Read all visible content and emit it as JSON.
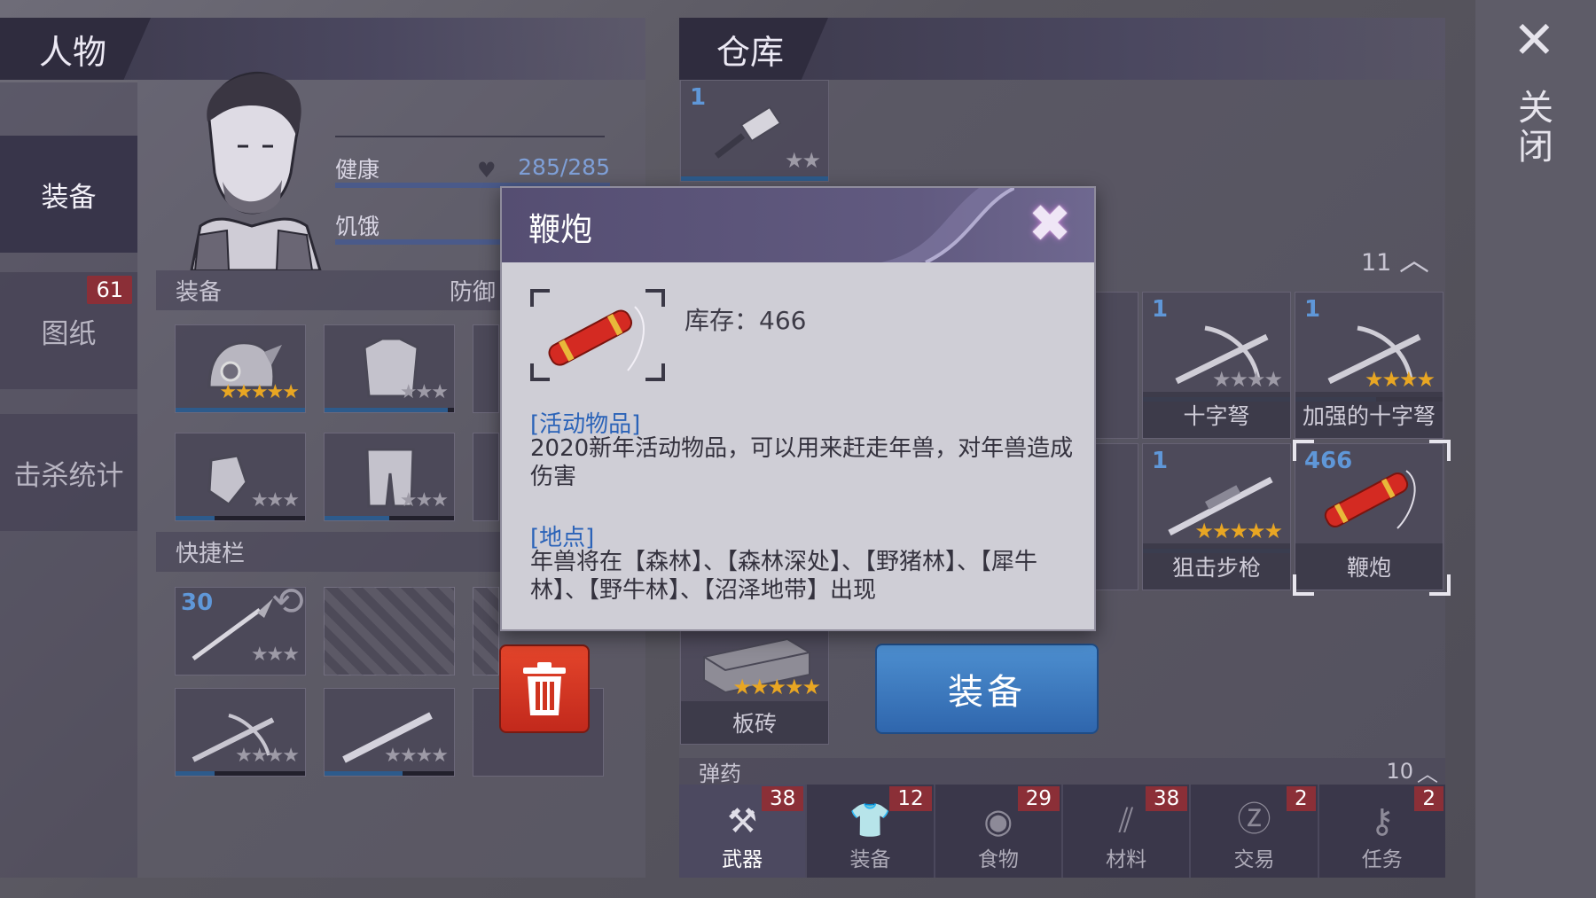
{
  "character_panel": {
    "title": "人物",
    "nav": [
      {
        "label": "装备",
        "active": true
      },
      {
        "label": "图纸",
        "badge": "61"
      },
      {
        "label": "击杀统计"
      }
    ],
    "stats": [
      {
        "label": "健康",
        "value": "285/285"
      },
      {
        "label": "饥饿",
        "value": ""
      }
    ],
    "equipment_label": "装备",
    "defense_label": "防御",
    "quickbar_label": "快捷栏",
    "quickbar_first_count": "30"
  },
  "storage_panel": {
    "title": "仓库",
    "top_item_count": "1",
    "section_count": "11",
    "items": [
      {
        "name": "十字弩",
        "count": "1",
        "stars_filled": 0,
        "stars_total": 4
      },
      {
        "name": "加强的十字弩",
        "count": "1",
        "stars_filled": 4,
        "stars_total": 4
      },
      {
        "name": "狙击步枪",
        "count": "1",
        "stars_filled": 5,
        "stars_total": 5
      },
      {
        "name": "鞭炮",
        "count": "466",
        "selected": true
      },
      {
        "name": "板砖",
        "stars_filled": 5,
        "stars_total": 5
      }
    ],
    "ammo_label": "弹药",
    "ammo_count": "10",
    "categories": [
      {
        "label": "武器",
        "badge": "38",
        "icon": "axe-icon",
        "active": true
      },
      {
        "label": "装备",
        "badge": "12",
        "icon": "shirt-icon"
      },
      {
        "label": "食物",
        "badge": "29",
        "icon": "meat-icon"
      },
      {
        "label": "材料",
        "badge": "38",
        "icon": "wood-icon"
      },
      {
        "label": "交易",
        "badge": "2",
        "icon": "coin-icon"
      },
      {
        "label": "任务",
        "badge": "2",
        "icon": "key-icon"
      }
    ]
  },
  "close": {
    "label": "关闭"
  },
  "modal": {
    "title": "鞭炮",
    "stock": "库存：466",
    "type_heading": "[活动物品]",
    "type_text": "2020新年活动物品，可以用来赶走年兽，对年兽造成伤害",
    "location_heading": "[地点]",
    "location_text": "年兽将在【森林】、【森林深处】、【野猪林】、【犀牛林】、【野牛林】、【沼泽地带】出现"
  },
  "buttons": {
    "equip": "装备"
  },
  "colors": {
    "accent_blue": "#2f66ad",
    "badge_red": "#8b2f37",
    "trash_red": "#d0341f",
    "star_gold": "#e8a623"
  }
}
